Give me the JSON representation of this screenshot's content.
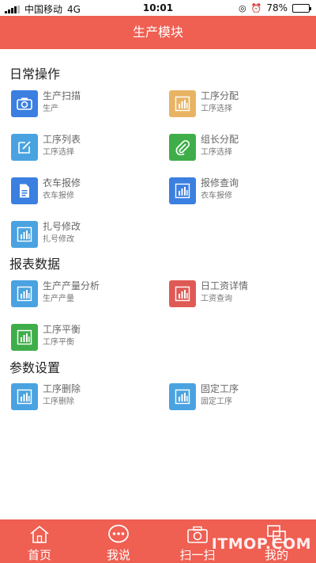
{
  "status_bar": {
    "carrier": "中国移动",
    "network": "4G",
    "time": "10:01",
    "battery": "78%",
    "battery_level": 0.78
  },
  "header": {
    "title": "生产模块"
  },
  "sections": {
    "daily": {
      "title": "日常操作"
    },
    "reports": {
      "title": "报表数据"
    },
    "params": {
      "title": "参数设置"
    }
  },
  "items": {
    "scan": {
      "title": "生产扫描",
      "sub": "生产",
      "color": "#3b7fe0",
      "icon": "camera-icon"
    },
    "proc_assign": {
      "title": "工序分配",
      "sub": "工序选择",
      "color": "#e8b464",
      "icon": "bar-chart-icon"
    },
    "proc_list": {
      "title": "工序列表",
      "sub": "工序选择",
      "color": "#4aa3e0",
      "icon": "edit-icon"
    },
    "leader_assign": {
      "title": "组长分配",
      "sub": "工序选择",
      "color": "#3fae4a",
      "icon": "paperclip-icon"
    },
    "repair_report": {
      "title": "衣车报修",
      "sub": "衣车报修",
      "color": "#3b7fe0",
      "icon": "document-icon"
    },
    "repair_query": {
      "title": "报修查询",
      "sub": "衣车报修",
      "color": "#3b7fe0",
      "icon": "bar-chart-icon"
    },
    "tag_modify": {
      "title": "扎号修改",
      "sub": "扎号修改",
      "color": "#4aa3e0",
      "icon": "bar-chart-icon"
    },
    "output_analysis": {
      "title": "生产产量分析",
      "sub": "生产产量",
      "color": "#4aa3e0",
      "icon": "bar-chart-icon"
    },
    "daily_wage": {
      "title": "日工资详情",
      "sub": "工资查询",
      "color": "#e05a55",
      "icon": "bar-chart-icon"
    },
    "proc_balance": {
      "title": "工序平衡",
      "sub": "工序平衡",
      "color": "#3fae4a",
      "icon": "bar-chart-icon"
    },
    "proc_delete": {
      "title": "工序删除",
      "sub": "工序删除",
      "color": "#4aa3e0",
      "icon": "bar-chart-icon"
    },
    "fixed_proc": {
      "title": "固定工序",
      "sub": "固定工序",
      "color": "#4aa3e0",
      "icon": "bar-chart-icon"
    }
  },
  "tabs": {
    "home": "首页",
    "chat": "我说",
    "scan": "扫一扫",
    "mine": "我的"
  },
  "watermark": "ITMOP.COM"
}
